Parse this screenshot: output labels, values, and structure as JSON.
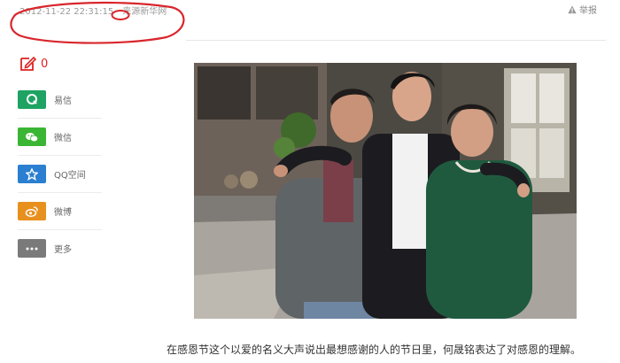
{
  "header": {
    "datetime": "2012-11-22 22:31:15",
    "source_label": "来源",
    "source_name": "新华网",
    "report_label": "举报"
  },
  "share": {
    "comment_count": "0",
    "items": [
      {
        "label": "易信",
        "icon": "yixin-icon",
        "color": "#1ea362"
      },
      {
        "label": "微信",
        "icon": "wechat-icon",
        "color": "#3bb534"
      },
      {
        "label": "QQ空间",
        "icon": "qzone-icon",
        "color": "#2b7fd1"
      },
      {
        "label": "微博",
        "icon": "weibo-icon",
        "color": "#e8901e"
      },
      {
        "label": "更多",
        "icon": "more-icon",
        "color": "#7a7a7a"
      }
    ]
  },
  "article": {
    "caption": "在感恩节这个以爱的名义大声说出最想感谢的人的节日里，何晟铭表达了对感恩的理解。"
  },
  "colors": {
    "annotation_red": "#d9262c",
    "comment_red": "#d22222"
  }
}
